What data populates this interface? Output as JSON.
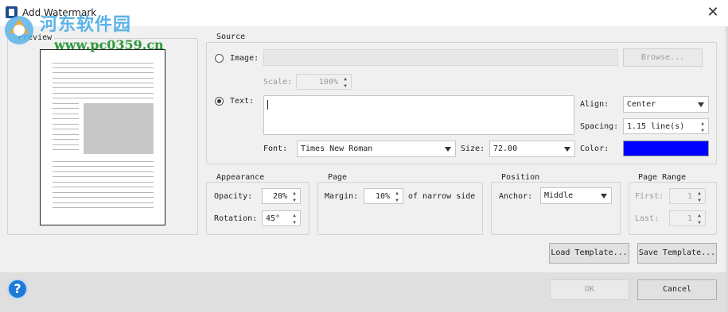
{
  "window": {
    "title": "Add Watermark",
    "close_glyph": "✕"
  },
  "site_watermark": {
    "name": "河东软件园",
    "url": "www.pc0359.cn"
  },
  "preview": {
    "legend": "Preview"
  },
  "source": {
    "legend": "Source",
    "image_label": "Image:",
    "image_value": "",
    "browse_label": "Browse...",
    "scale_label": "Scale:",
    "scale_value": "100%",
    "text_label": "Text:",
    "text_value": "",
    "selected_option": "Text",
    "align_label": "Align:",
    "align_value": "Center",
    "spacing_label": "Spacing:",
    "spacing_value": "1.15  line(s)",
    "font_label": "Font:",
    "font_value": "Times New Roman",
    "size_label": "Size:",
    "size_value": "72.00",
    "color_label": "Color:",
    "color_value": "#0000ff"
  },
  "appearance": {
    "legend": "Appearance",
    "opacity_label": "Opacity:",
    "opacity_value": "20%",
    "rotation_label": "Rotation:",
    "rotation_value": "45°"
  },
  "page": {
    "legend": "Page",
    "margin_label": "Margin:",
    "margin_value": "10%",
    "margin_suffix": "of narrow side"
  },
  "position": {
    "legend": "Position",
    "anchor_label": "Anchor:",
    "anchor_value": "Middle"
  },
  "page_range": {
    "legend": "Page Range",
    "first_label": "First:",
    "first_value": "1",
    "last_label": "Last:",
    "last_value": "1"
  },
  "templates": {
    "load_label": "Load Template...",
    "save_label": "Save Template..."
  },
  "footer": {
    "help_glyph": "?",
    "ok_label": "OK",
    "cancel_label": "Cancel"
  },
  "icons": {
    "app": "watermark-app-icon",
    "help": "help-icon",
    "close": "close-icon",
    "spin_up": "▲",
    "spin_down": "▼"
  }
}
